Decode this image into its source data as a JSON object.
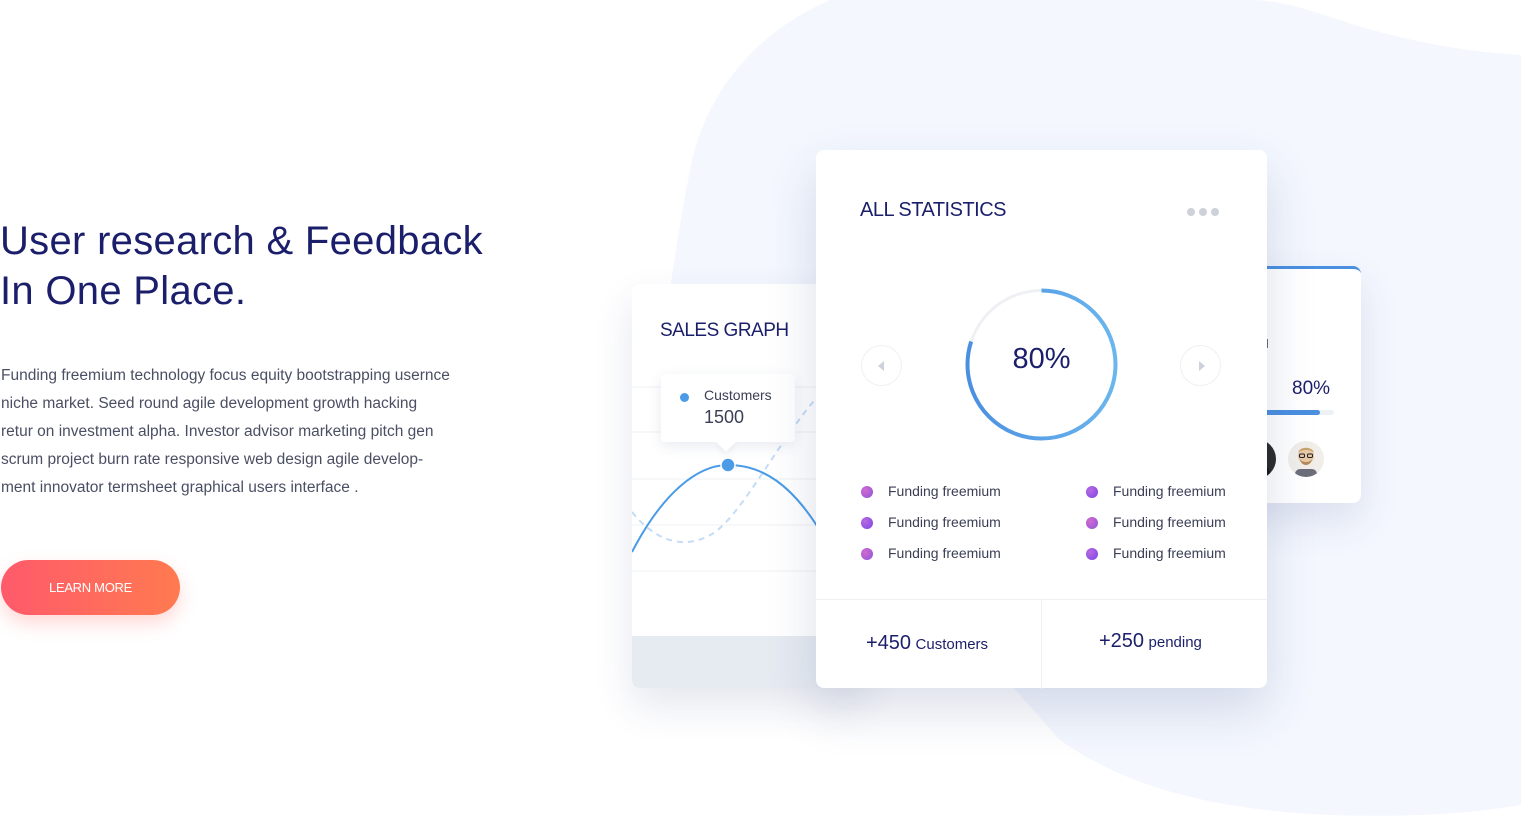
{
  "hero": {
    "title_line1": "User research & Feedback",
    "title_line2": "In One Place.",
    "description_lines": [
      "Funding freemium technology focus equity bootstrapping usernce",
      "niche market. Seed round agile development growth hacking",
      "retur on investment alpha. Investor advisor marketing pitch gen",
      "scrum project burn rate responsive web design agile develop-",
      "ment innovator termsheet graphical users interface ."
    ],
    "cta_label": "LEARN MORE"
  },
  "colors": {
    "primary_text": "#1b1f6b",
    "accent_blue": "#4b8fe0",
    "cta_gradient_start": "#ff5a6b",
    "cta_gradient_end": "#ff7a50",
    "background_blob": "#f4f7fe"
  },
  "sales_graph": {
    "title": "SALES GRAPH",
    "tooltip_label": "Customers",
    "tooltip_value": "1500"
  },
  "statistics": {
    "title": "ALL STATISTICS",
    "menu_icon": "more-horizontal-icon",
    "prev_icon": "chevron-left-icon",
    "next_icon": "chevron-right-icon",
    "progress_label": "80%",
    "progress_value": 0.8,
    "legend_left": [
      "Funding freemium",
      "Funding freemium",
      "Funding freemium"
    ],
    "legend_right": [
      "Funding freemium",
      "Funding freemium",
      "Funding freemium"
    ],
    "footer_left_number": "+450",
    "footer_left_label": "Customers",
    "footer_right_number": "+250",
    "footer_right_label": "pending"
  },
  "users_card": {
    "title_fragment": "ou",
    "percent_label": "80%",
    "progress_value": 0.8
  }
}
